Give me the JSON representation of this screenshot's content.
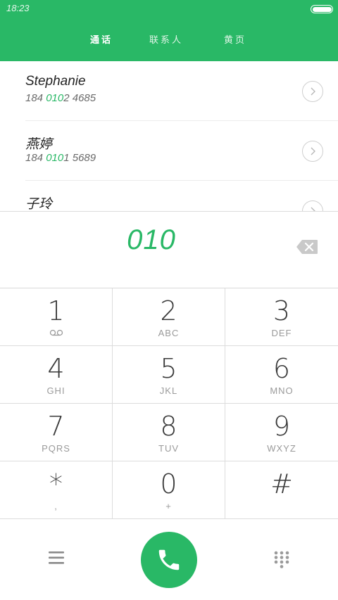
{
  "status_bar": {
    "time": "18:23"
  },
  "tabs": [
    {
      "label": "通话",
      "active": true
    },
    {
      "label": "联系人",
      "active": false
    },
    {
      "label": "黄页",
      "active": false
    }
  ],
  "contacts": [
    {
      "name": "Stephanie",
      "number_prefix": "184 ",
      "number_match": "010",
      "number_suffix": "2 4685"
    },
    {
      "name": "燕婷",
      "number_prefix": "184 ",
      "number_match": "010",
      "number_suffix": "1 5689"
    },
    {
      "name": "子玲",
      "number_prefix": "",
      "number_match": "",
      "number_suffix": ""
    }
  ],
  "dialer": {
    "dialed_number": "010"
  },
  "keypad": [
    {
      "digit": "1",
      "letters": "",
      "icon": "voicemail-icon"
    },
    {
      "digit": "2",
      "letters": "ABC"
    },
    {
      "digit": "3",
      "letters": "DEF"
    },
    {
      "digit": "4",
      "letters": "GHI"
    },
    {
      "digit": "5",
      "letters": "JKL"
    },
    {
      "digit": "6",
      "letters": "MNO"
    },
    {
      "digit": "7",
      "letters": "PQRS"
    },
    {
      "digit": "8",
      "letters": "TUV"
    },
    {
      "digit": "9",
      "letters": "WXYZ"
    },
    {
      "digit": "*",
      "letters": ","
    },
    {
      "digit": "0",
      "letters": "+"
    },
    {
      "digit": "#",
      "letters": ""
    }
  ],
  "colors": {
    "accent": "#29b866",
    "header_bg": "#29b866",
    "text_dark": "#3a3a3a",
    "text_muted": "#9a9a9a",
    "divider": "#dcdcdc"
  },
  "icons": {
    "menu": "menu-icon",
    "call": "phone-icon",
    "keypad_toggle": "dialpad-icon",
    "backspace": "backspace-icon",
    "detail": "chevron-right-icon"
  }
}
